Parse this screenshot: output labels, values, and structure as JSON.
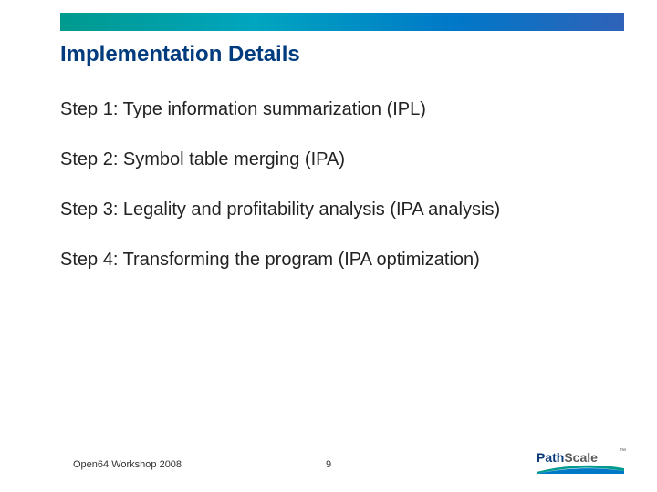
{
  "title": "Implementation Details",
  "steps": [
    "Step 1: Type information summarization (IPL)",
    "Step 2: Symbol table merging (IPA)",
    "Step 3: Legality and profitability analysis (IPA analysis)",
    "Step 4: Transforming the program (IPA optimization)"
  ],
  "footer": {
    "left": "Open64 Workshop 2008",
    "page": "9"
  },
  "logo": {
    "brand_part1": "Path",
    "brand_part2": "Scale",
    "tm": "™"
  }
}
